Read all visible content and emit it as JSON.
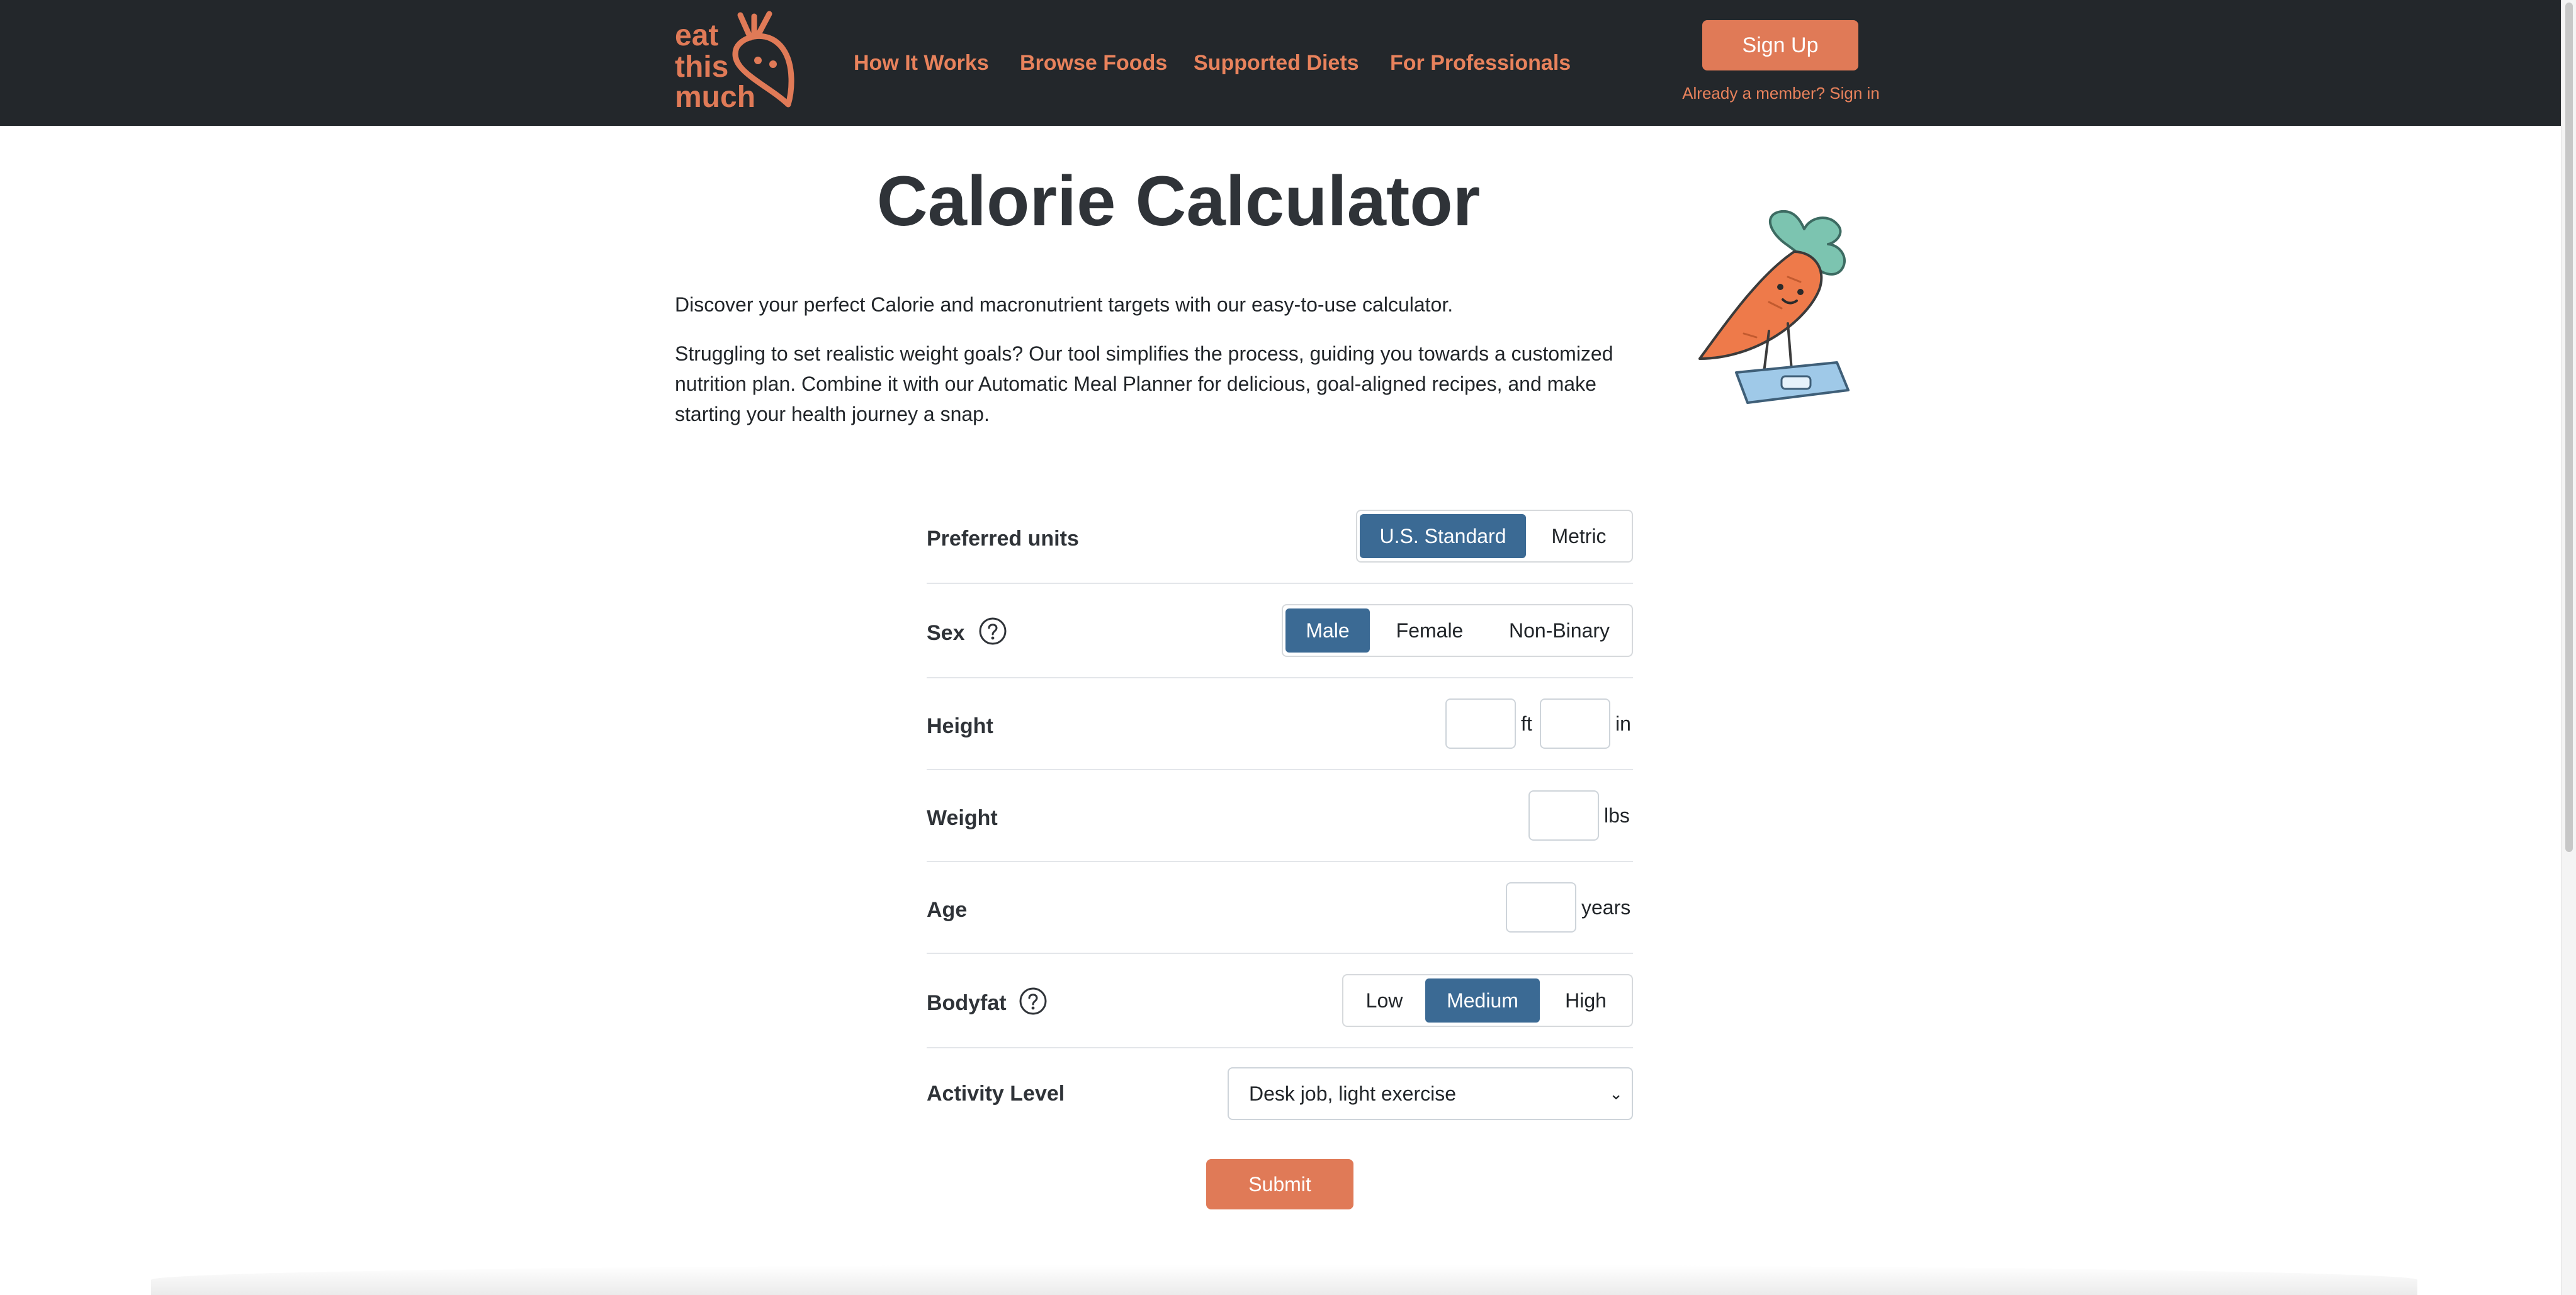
{
  "header": {
    "logo_text": "eat this much",
    "nav": [
      "How It Works",
      "Browse Foods",
      "Supported Diets",
      "For Professionals"
    ],
    "signup_label": "Sign Up",
    "signin_label": "Already a member? Sign in"
  },
  "colors": {
    "header_bg": "#23272b",
    "accent": "#e07a57",
    "link": "#e8825c",
    "active_segment": "#3b6a94"
  },
  "intro": {
    "title": "Calorie Calculator",
    "paragraph_1": "Discover your perfect Calorie and macronutrient targets with our easy-to-use calculator.",
    "paragraph_2": "Struggling to set realistic weight goals? Our tool simplifies the process, guiding you towards a customized nutrition plan. Combine it with our Automatic Meal Planner for delicious, goal-aligned recipes, and make starting your health journey a snap."
  },
  "form": {
    "units": {
      "label": "Preferred units",
      "options": [
        "U.S. Standard",
        "Metric"
      ],
      "selected": "U.S. Standard"
    },
    "sex": {
      "label": "Sex",
      "options": [
        "Male",
        "Female",
        "Non-Binary"
      ],
      "selected": "Male",
      "help_icon": "question-circle-icon"
    },
    "height": {
      "label": "Height",
      "feet_value": "",
      "inches_value": "",
      "feet_unit": "ft",
      "inches_unit": "in"
    },
    "weight": {
      "label": "Weight",
      "value": "",
      "unit": "lbs"
    },
    "age": {
      "label": "Age",
      "value": "",
      "unit": "years"
    },
    "bodyfat": {
      "label": "Bodyfat",
      "options": [
        "Low",
        "Medium",
        "High"
      ],
      "selected": "Medium",
      "help_icon": "question-circle-icon"
    },
    "activity": {
      "label": "Activity Level",
      "selected": "Desk job, light exercise"
    },
    "submit_label": "Submit"
  }
}
